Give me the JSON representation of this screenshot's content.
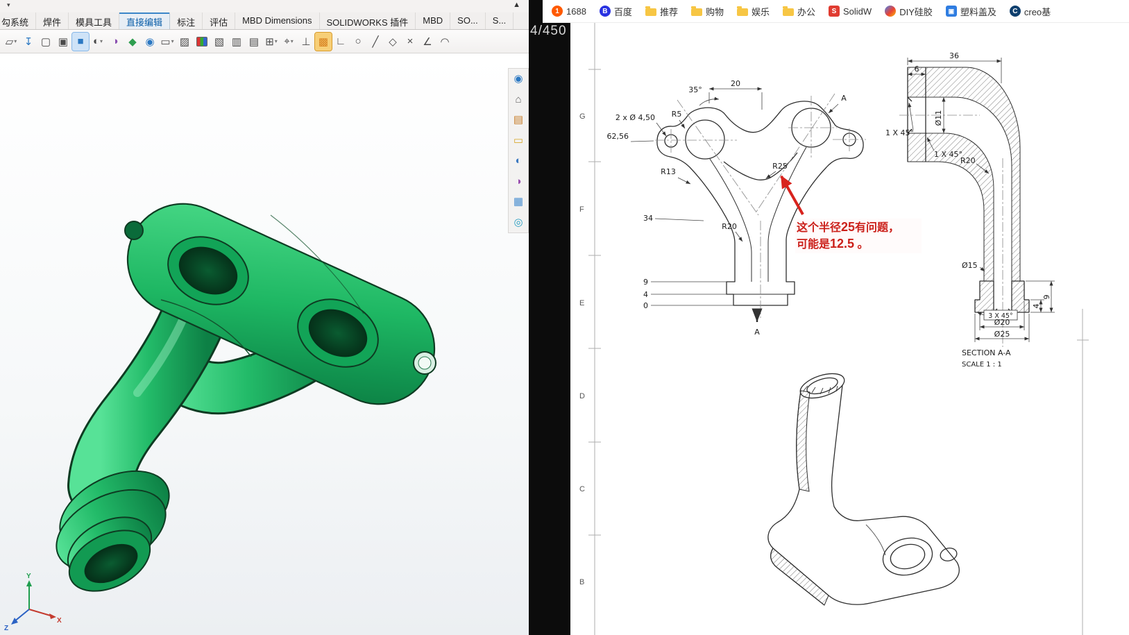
{
  "colors": {
    "model_green": "#1fb45f",
    "annotation_red": "#d8231d",
    "divider_black": "#0c0c0c",
    "folder_yellow": "#f7c644"
  },
  "left_app": {
    "menu_caret_glyph": "▾",
    "scroll_up_glyph": "▲",
    "tabs": [
      {
        "label": "勾系统",
        "active": false
      },
      {
        "label": "焊件",
        "active": false
      },
      {
        "label": "模具工具",
        "active": false
      },
      {
        "label": "直接编辑",
        "active": true
      },
      {
        "label": "标注",
        "active": false
      },
      {
        "label": "评估",
        "active": false
      },
      {
        "label": "MBD Dimensions",
        "active": false
      },
      {
        "label": "SOLIDWORKS 插件",
        "active": false
      },
      {
        "label": "MBD",
        "active": false
      },
      {
        "label": "SO...",
        "active": false
      },
      {
        "label": "S...",
        "active": false
      }
    ],
    "toolbar": {
      "icons": [
        {
          "name": "cascade-window-icon",
          "glyph": "▱"
        },
        {
          "name": "export-icon",
          "glyph": "↧"
        },
        {
          "name": "ghost-cube-icon",
          "glyph": "▢"
        },
        {
          "name": "copy-cube-icon",
          "glyph": "▣"
        },
        {
          "name": "instant3d-cube-icon",
          "glyph": "■"
        },
        {
          "name": "orientation-sphere-icon",
          "glyph": "◐"
        },
        {
          "name": "appearance-sphere-icon",
          "glyph": "◑"
        },
        {
          "name": "swatch-icon",
          "glyph": "◆"
        },
        {
          "name": "render-globe-icon",
          "glyph": "◉"
        },
        {
          "name": "monitor-icon",
          "glyph": "▭"
        },
        {
          "name": "image-icon",
          "glyph": "▨"
        },
        {
          "name": "rgb-color-icon",
          "glyph": ""
        },
        {
          "name": "hatch-icon",
          "glyph": "▧"
        },
        {
          "name": "columns-icon",
          "glyph": "▥"
        },
        {
          "name": "rows-icon",
          "glyph": "▤"
        },
        {
          "name": "cells-icon",
          "glyph": "⊞"
        },
        {
          "name": "pin-icon",
          "glyph": "⌖"
        },
        {
          "name": "perpendicular-icon",
          "glyph": "⊥"
        },
        {
          "name": "highlight-icon",
          "glyph": "▩"
        },
        {
          "name": "corner-icon",
          "glyph": "∟"
        },
        {
          "name": "circle-tool-icon",
          "glyph": "○"
        },
        {
          "name": "line-tool-icon",
          "glyph": "╱"
        },
        {
          "name": "polygon-tool-icon",
          "glyph": "◇"
        },
        {
          "name": "trim-tool-icon",
          "glyph": "×"
        },
        {
          "name": "angle-tool-icon",
          "glyph": "∠"
        },
        {
          "name": "arc-tool-icon",
          "glyph": "◠"
        }
      ]
    },
    "taskpane": {
      "icons": [
        {
          "name": "web-icon",
          "glyph": "◉"
        },
        {
          "name": "home-icon",
          "glyph": "⌂"
        },
        {
          "name": "design-library-icon",
          "glyph": "▤"
        },
        {
          "name": "file-explorer-icon",
          "glyph": "▭"
        },
        {
          "name": "appearances-icon",
          "glyph": "◐"
        },
        {
          "name": "scene-icon",
          "glyph": "◑"
        },
        {
          "name": "view-palette-icon",
          "glyph": "▦"
        },
        {
          "name": "browser-icon",
          "glyph": "◎"
        }
      ]
    },
    "triad": {
      "x": "X",
      "y": "Y",
      "z": "Z"
    }
  },
  "viewer": {
    "page_indicator": "4/450"
  },
  "bookmarks_bar": {
    "items": [
      {
        "label": "1688",
        "glyph": "1"
      },
      {
        "label": "百度",
        "glyph": "B"
      },
      {
        "label": "推荐",
        "glyph": ""
      },
      {
        "label": "购物",
        "glyph": ""
      },
      {
        "label": "娱乐",
        "glyph": ""
      },
      {
        "label": "办公",
        "glyph": ""
      },
      {
        "label": "SolidW",
        "glyph": "S"
      },
      {
        "label": "DIY硅胶",
        "glyph": ""
      },
      {
        "label": "塑料盖及",
        "glyph": "▣"
      },
      {
        "label": "creo基",
        "glyph": "C"
      }
    ]
  },
  "drawing": {
    "zones": [
      "G",
      "F",
      "E",
      "D",
      "C",
      "B"
    ],
    "front_view": {
      "dim_angle": "35°",
      "dim_width": "20",
      "dim_holes": "2 x Ø 4,50",
      "dim_r5": "R5",
      "dim_height": "62,56",
      "dim_r13": "R13",
      "dim_34": "34",
      "dim_r20": "R20",
      "dim_r25": "R25",
      "dim_9": "9",
      "dim_4": "4",
      "dim_0": "0",
      "datum_a": "A",
      "section_a": "A"
    },
    "section_view": {
      "dim_36": "36",
      "dim_6": "6",
      "dim_d11": "Ø11",
      "dim_chamfer_top": "1 X 45°",
      "dim_chamfer_bottom": "1 X 45°",
      "dim_r20": "R20",
      "dim_d15": "Ø15",
      "dim_chamfer3": "3 X 45°",
      "dim_d20": "Ø20",
      "dim_d25": "Ø25",
      "dim_4": "4",
      "dim_9": "9",
      "title": "SECTION A-A",
      "scale": "SCALE 1 : 1"
    },
    "annotation": {
      "line1_pre": "这个半径",
      "line1_num": "25",
      "line1_post": "有问题，",
      "line2_pre": "可能是",
      "line2_num": "12.5",
      "line2_post": " 。"
    }
  }
}
